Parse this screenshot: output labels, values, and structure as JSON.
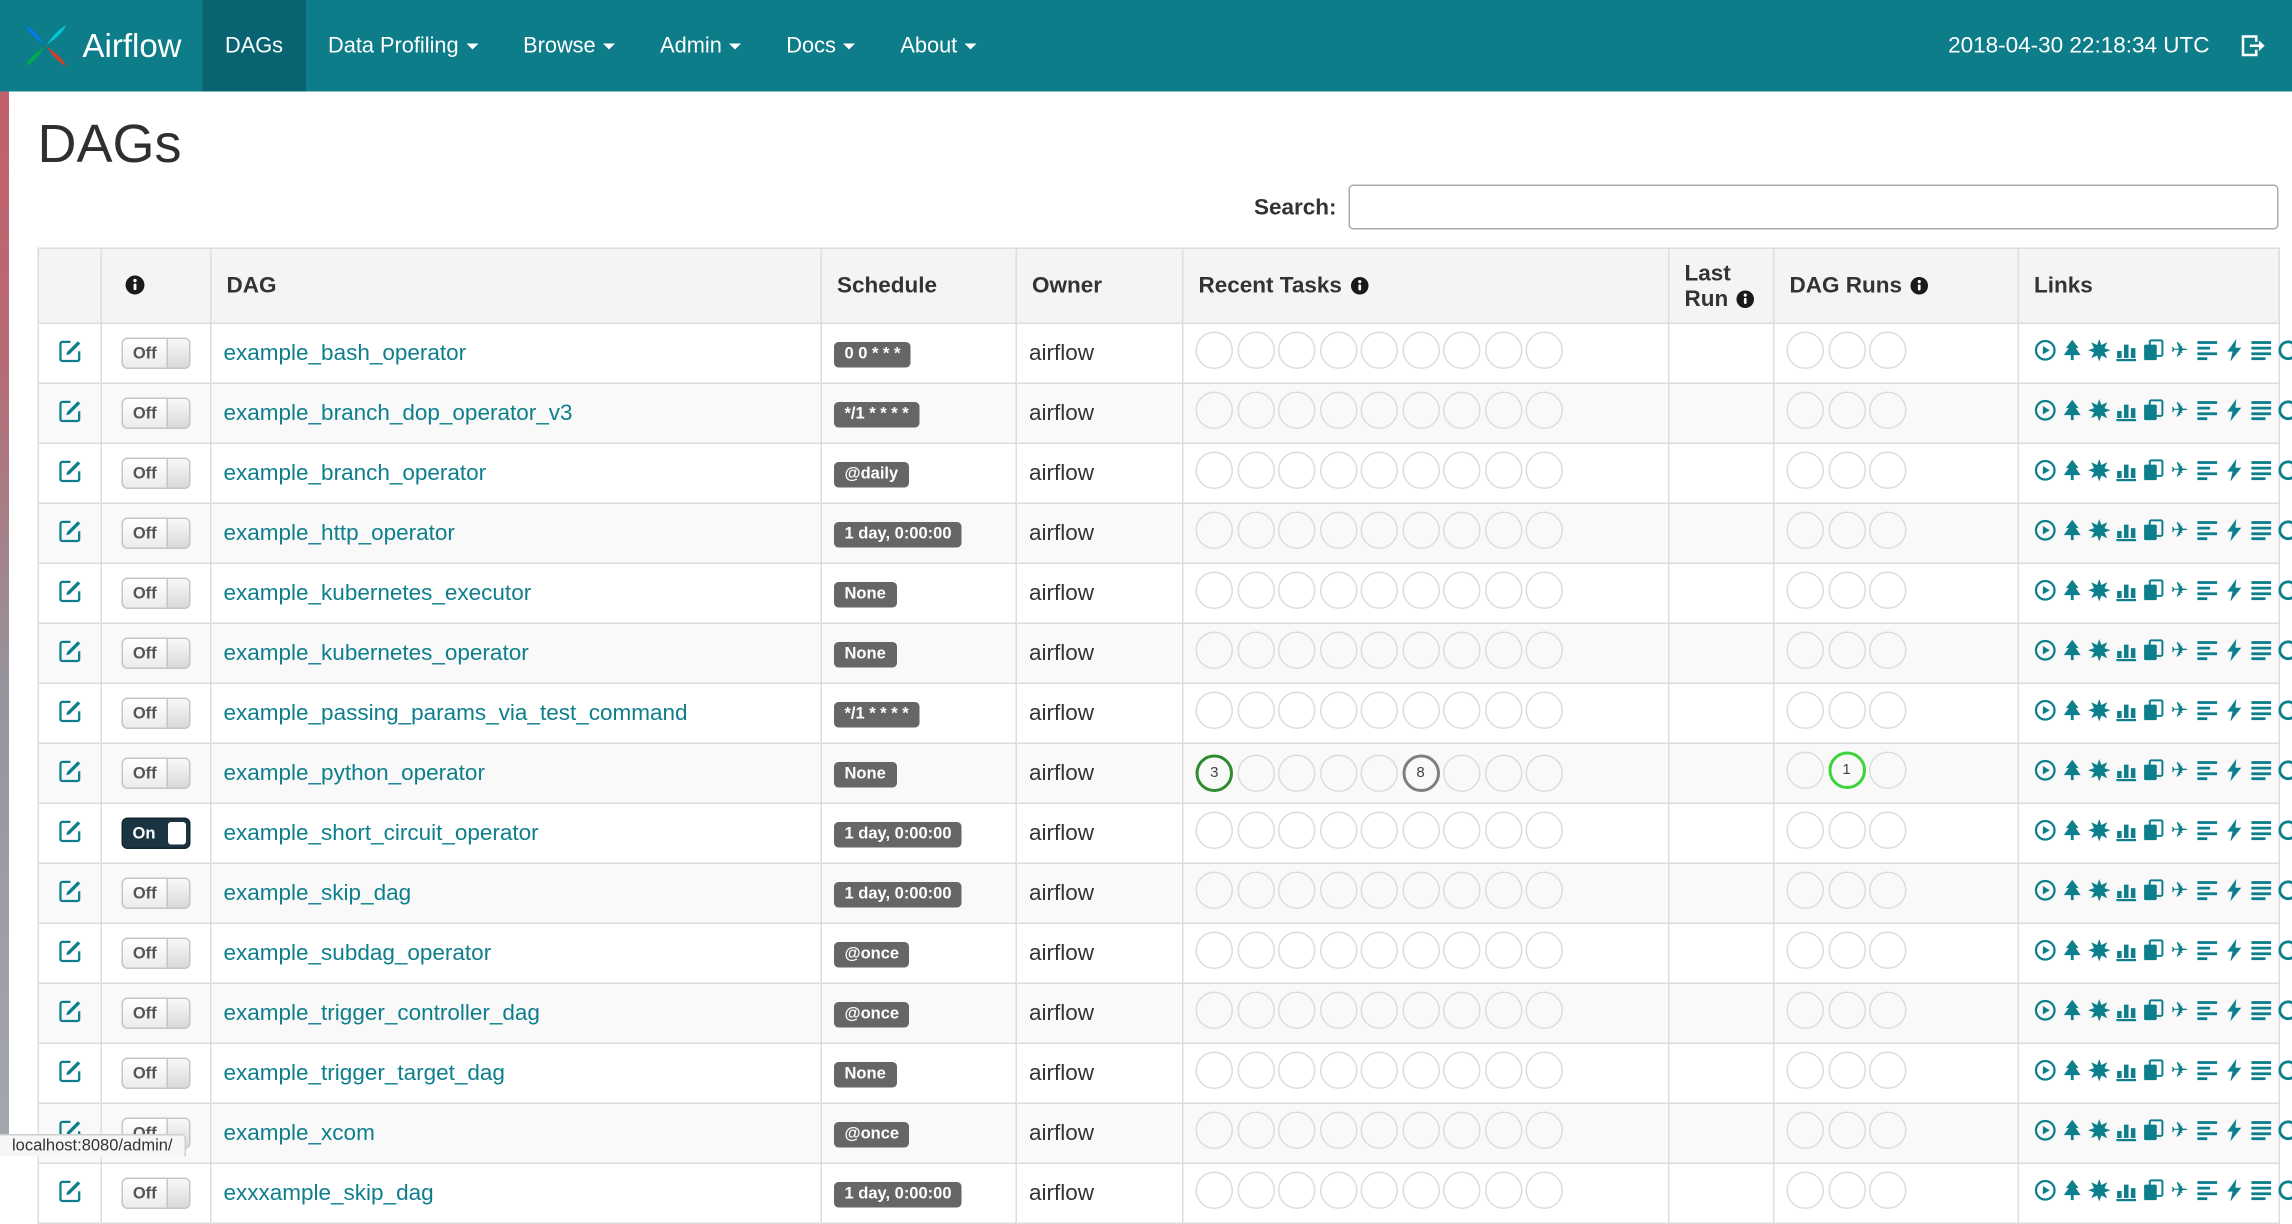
{
  "navbar": {
    "brand": "Airflow",
    "clock": "2018-04-30 22:18:34 UTC",
    "items": [
      {
        "label": "DAGs",
        "active": true
      },
      {
        "label": "Data Profiling",
        "active": false
      },
      {
        "label": "Browse",
        "active": false
      },
      {
        "label": "Admin",
        "active": false
      },
      {
        "label": "Docs",
        "active": false
      },
      {
        "label": "About",
        "active": false
      }
    ]
  },
  "page": {
    "title": "DAGs"
  },
  "search": {
    "label": "Search:",
    "value": ""
  },
  "table": {
    "headers": {
      "dag": "DAG",
      "schedule": "Schedule",
      "owner": "Owner",
      "recent_tasks": "Recent Tasks",
      "last_run": "Last Run",
      "dag_runs": "DAG Runs",
      "links": "Links"
    },
    "recent_task_slots": 9,
    "dag_run_slots": 3,
    "link_titles": [
      "Trigger Dag",
      "Tree View",
      "Graph View",
      "Tasks Duration",
      "Task Tries",
      "Landing Times",
      "Gantt View",
      "Code View",
      "Logs",
      "Refresh"
    ],
    "state_colors": {
      "success": "#2e8b2e",
      "running": "#3bd43b",
      "queued": "#7f7f7f"
    },
    "rows": [
      {
        "dag": "example_bash_operator",
        "toggle": "Off",
        "schedule": "0 0 * * *",
        "owner": "airflow",
        "recent_tasks": [],
        "dag_runs": []
      },
      {
        "dag": "example_branch_dop_operator_v3",
        "toggle": "Off",
        "schedule": "*/1 * * * *",
        "owner": "airflow",
        "recent_tasks": [],
        "dag_runs": []
      },
      {
        "dag": "example_branch_operator",
        "toggle": "Off",
        "schedule": "@daily",
        "owner": "airflow",
        "recent_tasks": [],
        "dag_runs": []
      },
      {
        "dag": "example_http_operator",
        "toggle": "Off",
        "schedule": "1 day, 0:00:00",
        "owner": "airflow",
        "recent_tasks": [],
        "dag_runs": []
      },
      {
        "dag": "example_kubernetes_executor",
        "toggle": "Off",
        "schedule": "None",
        "owner": "airflow",
        "recent_tasks": [],
        "dag_runs": []
      },
      {
        "dag": "example_kubernetes_operator",
        "toggle": "Off",
        "schedule": "None",
        "owner": "airflow",
        "recent_tasks": [],
        "dag_runs": []
      },
      {
        "dag": "example_passing_params_via_test_command",
        "toggle": "Off",
        "schedule": "*/1 * * * *",
        "owner": "airflow",
        "recent_tasks": [],
        "dag_runs": []
      },
      {
        "dag": "example_python_operator",
        "toggle": "Off",
        "schedule": "None",
        "owner": "airflow",
        "recent_tasks": [
          {
            "slot": 0,
            "count": "3",
            "state": "success"
          },
          {
            "slot": 5,
            "count": "8",
            "state": "queued"
          }
        ],
        "dag_runs": [
          {
            "slot": 1,
            "count": "1",
            "state": "running"
          }
        ]
      },
      {
        "dag": "example_short_circuit_operator",
        "toggle": "On",
        "schedule": "1 day, 0:00:00",
        "owner": "airflow",
        "recent_tasks": [],
        "dag_runs": []
      },
      {
        "dag": "example_skip_dag",
        "toggle": "Off",
        "schedule": "1 day, 0:00:00",
        "owner": "airflow",
        "recent_tasks": [],
        "dag_runs": []
      },
      {
        "dag": "example_subdag_operator",
        "toggle": "Off",
        "schedule": "@once",
        "owner": "airflow",
        "recent_tasks": [],
        "dag_runs": []
      },
      {
        "dag": "example_trigger_controller_dag",
        "toggle": "Off",
        "schedule": "@once",
        "owner": "airflow",
        "recent_tasks": [],
        "dag_runs": []
      },
      {
        "dag": "example_trigger_target_dag",
        "toggle": "Off",
        "schedule": "None",
        "owner": "airflow",
        "recent_tasks": [],
        "dag_runs": []
      },
      {
        "dag": "example_xcom",
        "toggle": "Off",
        "schedule": "@once",
        "owner": "airflow",
        "recent_tasks": [],
        "dag_runs": []
      },
      {
        "dag": "exxxample_skip_dag",
        "toggle": "Off",
        "schedule": "1 day, 0:00:00",
        "owner": "airflow",
        "recent_tasks": [],
        "dag_runs": []
      }
    ]
  },
  "status_bar": {
    "url": "localhost:8080/admin/"
  },
  "colors": {
    "navbar_bg": "#0e7d8a",
    "navbar_active_bg": "#076470",
    "accent": "#0d7f8c",
    "badge_bg": "#666666",
    "toggle_on_bg": "#1b3442"
  }
}
